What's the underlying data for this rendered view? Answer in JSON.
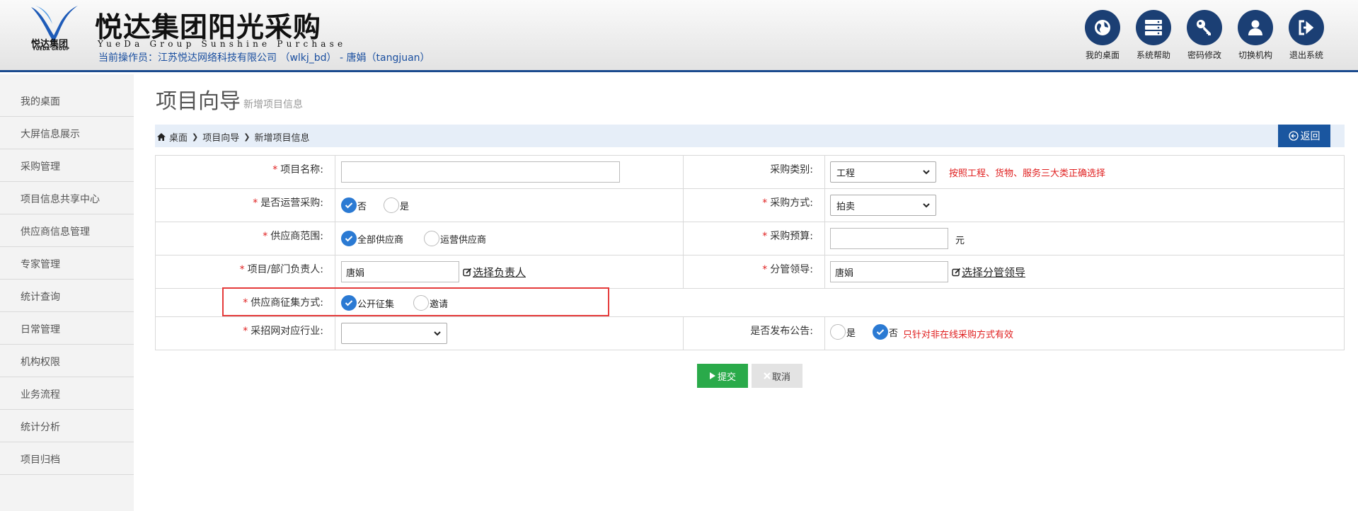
{
  "header": {
    "logo_cn": "悦达集团",
    "logo_en": "YUEDA GROUP",
    "brand_title": "悦达集团阳光采购",
    "brand_subtitle": "YueDa Group Sunshine Purchase",
    "operator": "当前操作员：江苏悦达网络科技有限公司 （wlkj_bd） - 唐娟（tangjuan）",
    "tools": [
      {
        "label": "我的桌面",
        "icon": "globe-icon"
      },
      {
        "label": "系统帮助",
        "icon": "server-icon"
      },
      {
        "label": "密码修改",
        "icon": "key-icon"
      },
      {
        "label": "切换机构",
        "icon": "user-icon"
      },
      {
        "label": "退出系统",
        "icon": "sign-out-icon"
      }
    ]
  },
  "sidebar": {
    "items": [
      "我的桌面",
      "大屏信息展示",
      "采购管理",
      "项目信息共享中心",
      "供应商信息管理",
      "专家管理",
      "统计查询",
      "日常管理",
      "机构权限",
      "业务流程",
      "统计分析",
      "项目归档"
    ]
  },
  "page": {
    "title": "项目向导",
    "subtitle": "新增项目信息",
    "breadcrumb": [
      "桌面",
      "项目向导",
      "新增项目信息"
    ],
    "back_label": "返回"
  },
  "form": {
    "project_name": {
      "label": "项目名称:",
      "value": ""
    },
    "category": {
      "label": "采购类别:",
      "value": "工程",
      "note": "按照工程、货物、服务三大类正确选择"
    },
    "operational": {
      "label": "是否运营采购:",
      "options": [
        "否",
        "是"
      ],
      "selected": "否"
    },
    "method": {
      "label": "采购方式:",
      "value": "拍卖"
    },
    "supplier_scope": {
      "label": "供应商范围:",
      "options": [
        "全部供应商",
        "运营供应商"
      ],
      "selected": "全部供应商"
    },
    "budget": {
      "label": "采购预算:",
      "value": "",
      "unit": "元"
    },
    "owner": {
      "label": "项目/部门负责人:",
      "value": "唐娟",
      "link": "选择负责人"
    },
    "leader": {
      "label": "分管领导:",
      "value": "唐娟",
      "link": "选择分管领导"
    },
    "solicitation": {
      "label": "供应商征集方式:",
      "options": [
        "公开征集",
        "邀请"
      ],
      "selected": "公开征集"
    },
    "industry": {
      "label": "采招网对应行业:",
      "value": ""
    },
    "publish": {
      "label": "是否发布公告:",
      "options": [
        "是",
        "否"
      ],
      "selected": "否",
      "note": "只针对非在线采购方式有效"
    }
  },
  "actions": {
    "submit": "提交",
    "cancel": "取消"
  },
  "colors": {
    "brand_blue": "#1a4a8e",
    "tool_icon_bg": "#1b3f74",
    "required_red": "#e02020",
    "submit_green": "#2aaa4a",
    "radio_blue": "#2b7ad3",
    "highlight_red": "#e53b3b"
  }
}
